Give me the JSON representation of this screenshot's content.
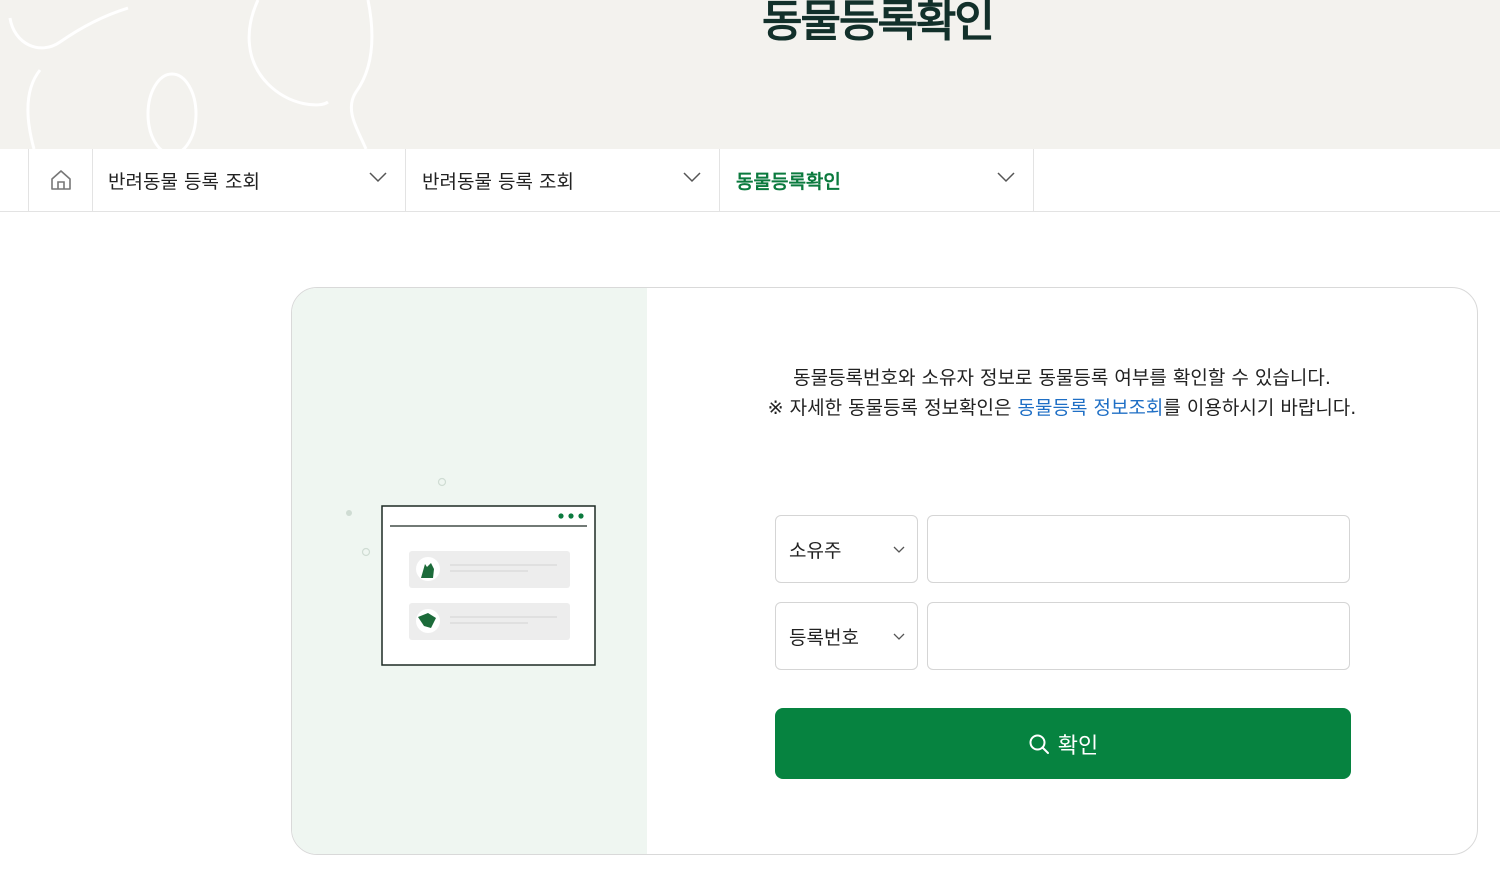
{
  "header": {
    "title": "동물등록확인"
  },
  "breadcrumb": {
    "home_icon": "home-icon",
    "items": [
      {
        "label": "반려동물 등록 조회"
      },
      {
        "label": "반려동물 등록 조회"
      },
      {
        "label": "동물등록확인"
      }
    ]
  },
  "content": {
    "description_line1": "동물등록번호와 소유자 정보로 동물등록 여부를 확인할 수 있습니다.",
    "description_prefix": "※ 자세한 동물등록 정보확인은 ",
    "description_link": "동물등록 정보조회",
    "description_suffix": "를 이용하시기 바랍니다.",
    "form": {
      "owner_select": "소유주",
      "owner_value": "",
      "reg_select": "등록번호",
      "reg_value": ""
    },
    "confirm_label": "확인"
  },
  "colors": {
    "brand_green": "#068340",
    "title": "#12302a",
    "link": "#1f6fc5"
  }
}
